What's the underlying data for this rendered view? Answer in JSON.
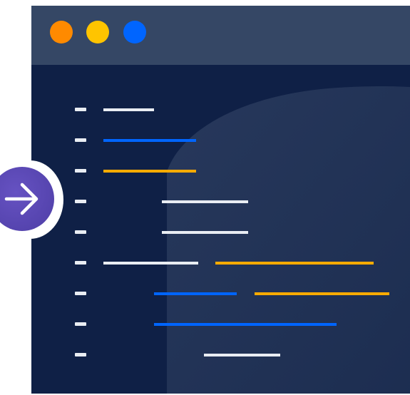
{
  "window": {
    "titlebar_color": "#354765",
    "body_color": "#0f2046",
    "traffic_lights": [
      {
        "name": "orange-dot",
        "color": "#ff8a00"
      },
      {
        "name": "yellow-dot",
        "color": "#ffc400"
      },
      {
        "name": "blue-dot",
        "color": "#0065ff"
      }
    ]
  },
  "code_lines": [
    {
      "segments": [
        {
          "color": "#e9edf3"
        }
      ]
    },
    {
      "segments": [
        {
          "color": "#0065ff"
        }
      ]
    },
    {
      "segments": [
        {
          "color": "#ffab00"
        }
      ]
    },
    {
      "segments": [
        {
          "color": "#e9edf3"
        }
      ]
    },
    {
      "segments": [
        {
          "color": "#e9edf3"
        }
      ]
    },
    {
      "segments": [
        {
          "color": "#e9edf3"
        },
        {
          "color": "#ffab00"
        }
      ]
    },
    {
      "segments": [
        {
          "color": "#0065ff"
        },
        {
          "color": "#ffab00"
        }
      ]
    },
    {
      "segments": [
        {
          "color": "#0065ff"
        }
      ]
    },
    {
      "segments": [
        {
          "color": "#e9edf3"
        }
      ]
    }
  ],
  "nav_button": {
    "icon": "arrow-right-icon",
    "color": "#5b4ab3"
  }
}
